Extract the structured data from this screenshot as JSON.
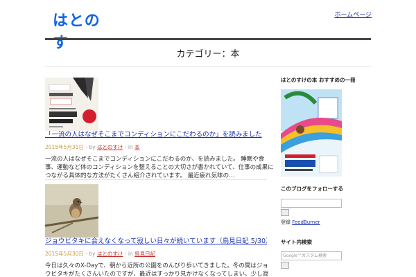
{
  "site": {
    "logo_text": "はとのす",
    "nav_link": "ホームページ"
  },
  "page": {
    "title": "カテゴリー：本"
  },
  "posts": [
    {
      "title": "「一流の人はなぜそこまでコンディションにこだわるのか」を読みました",
      "date": "2015年5月31日",
      "by": " - by ",
      "author": "はとのすけ",
      "in": " - in ",
      "category": "本",
      "excerpt": "一流の人はなぜそこまでコンディションにこだわるのか、を読みました。 睡眠や食事、運動など体のコンディションを整えることの大切さが書かれていて、仕事の成果につながる具体的な方法がたくさん紹介されています。 最近疲れ気味の…"
    },
    {
      "title": "ジョウビタキに会えなくなって寂しい日々が続いています（鳥見日記 5/30）",
      "date": "2015年5月30日",
      "by": " - by ",
      "author": "はとのすけ",
      "in": " - in ",
      "category": "鳥見日記",
      "excerpt": "今日は久々のX-Dayで、朝から近所の公園をのんびり歩いてきました。冬の間はジョウビタキがたくさんいたのですが、最近はすっかり見かけなくなってしまい、少し寂しい気持ちです。 その代わりにカワラヒワやシジュウカラの声が…"
    }
  ],
  "sidebar": {
    "book_widget_title": "はとのすけの本 おすすめの一冊",
    "rss_widget_title": "このブログをフォローする",
    "rss_prefix": "登録 ",
    "rss_link": "FeedBurner",
    "search_widget_title": "サイト内検索",
    "search_placeholder": "Google™カスタム検索"
  },
  "colors": {
    "logo": "#1463e6",
    "link": "#1a2fb0",
    "date": "#c99a3a",
    "meta_link": "#c0302a"
  }
}
